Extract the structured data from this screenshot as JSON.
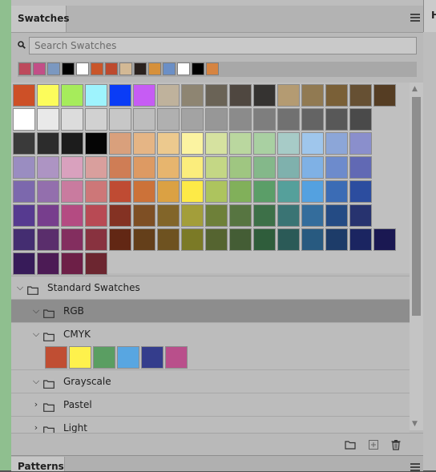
{
  "panel": {
    "title": "Swatches",
    "edge_tab_label": "H"
  },
  "search": {
    "placeholder": "Search Swatches",
    "value": ""
  },
  "recent_colors": [
    "#bd4a5c",
    "#c24f87",
    "#7b98c0",
    "#000000",
    "#ffffff",
    "#c9562a",
    "#bd4a2e",
    "#d3b995",
    "#2a211d",
    "#d6903a",
    "#6b8fc6",
    "#ffffff",
    "#000000",
    "#d68441"
  ],
  "grid_rows": [
    [
      "#cd5027",
      "#fcfc5b",
      "#a6ec5b",
      "#9ef3fd",
      "#0a3cf6",
      "#c65cf4",
      "#bfb29c",
      "#8e8572",
      "#6a6356",
      "#4f4740",
      "#353331",
      "#b49b72",
      "#917a52",
      "#7a6037",
      "#665033",
      "#553d23"
    ],
    [
      "#ffffff",
      "#e9e9e9",
      "#dcdcdc",
      "#d1d1d1",
      "#c7c7c7",
      "#bdbdbd",
      "#b0b0b0",
      "#a3a3a3",
      "#979797",
      "#8b8b8b",
      "#7e7e7e",
      "#717171",
      "#646464",
      "#585858",
      "#4a4a4a"
    ],
    [
      "#3a3a3a",
      "#2c2c2c",
      "#1c1c1c",
      "#050505",
      "#d9a07c",
      "#e5b585",
      "#ecc98e",
      "#fbf3a1",
      "#d6e2a0",
      "#bad79f",
      "#a9d0a2",
      "#a7cbc7",
      "#9fc6ec",
      "#8ca6d8",
      "#8a8fcc"
    ],
    [
      "#9a8dc1",
      "#ad94c3",
      "#d9a1be",
      "#d99f9d",
      "#cf7d55",
      "#dd9a63",
      "#e7b56e",
      "#fbed7c",
      "#c4d785",
      "#9fc681",
      "#84b88a",
      "#7fb1ad",
      "#7fb1e5",
      "#6d8bcc",
      "#6169b4"
    ],
    [
      "#7c68ad",
      "#936fad",
      "#c97b9f",
      "#cd7778",
      "#bf4b33",
      "#cc7239",
      "#dba143",
      "#fdea47",
      "#adc45e",
      "#81b05a",
      "#5b9e68",
      "#55a09b",
      "#54a1e0",
      "#3b6cb5",
      "#2c4d9f"
    ],
    [
      "#563a90",
      "#773e8d",
      "#b44b82",
      "#b84a54",
      "#843223",
      "#7e4f24",
      "#826529",
      "#a39e3a",
      "#6e8039",
      "#577541",
      "#3d7048",
      "#3a7474",
      "#346d9c",
      "#244b84",
      "#27336f"
    ],
    [
      "#442d71",
      "#5a2e6c",
      "#832e5f",
      "#88323f",
      "#622714",
      "#643f1a",
      "#6e5220",
      "#7b7a26",
      "#556430",
      "#445d35",
      "#2f5d3b",
      "#2b5a57",
      "#285a80",
      "#1d3c69",
      "#1b2561",
      "#1a1852"
    ],
    [
      "#371b59",
      "#4c1b55",
      "#6d1f47",
      "#6c2630"
    ]
  ],
  "groups": [
    {
      "label": "Standard Swatches",
      "expanded": true,
      "depth": 0,
      "selected": false
    },
    {
      "label": "RGB",
      "expanded": true,
      "depth": 1,
      "selected": true
    },
    {
      "label": "CMYK",
      "expanded": true,
      "depth": 1,
      "selected": false
    },
    {
      "label": "Grayscale",
      "expanded": true,
      "depth": 1,
      "selected": false
    },
    {
      "label": "Pastel",
      "expanded": false,
      "depth": 1,
      "selected": false
    },
    {
      "label": "Light",
      "expanded": false,
      "depth": 1,
      "selected": false
    }
  ],
  "cmyk_colors": [
    "#c04e33",
    "#fef14c",
    "#5a9e62",
    "#58a6e1",
    "#343d8c",
    "#b94f8b"
  ],
  "footer_icons": [
    "folder-icon",
    "add-swatch-icon",
    "trash-icon"
  ],
  "next_panel": {
    "title": "Patterns"
  }
}
